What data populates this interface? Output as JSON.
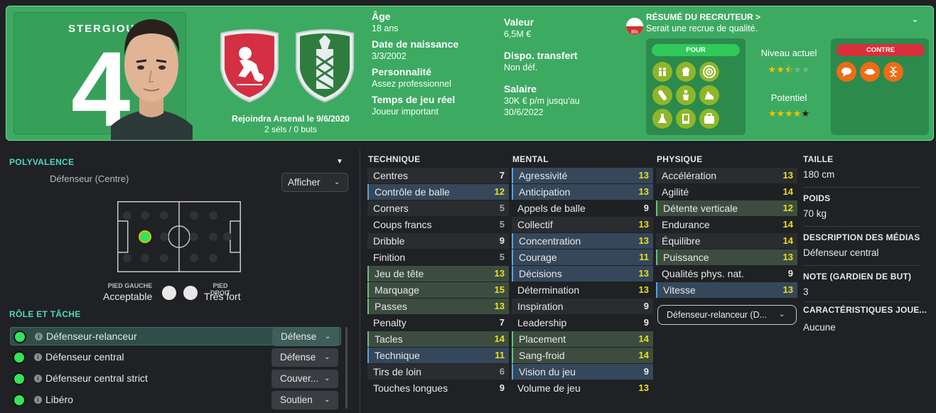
{
  "player": {
    "surname": "STERGIOU",
    "number": "4",
    "joined": "Rejoindra Arsenal le 9/6/2020",
    "caps": "2 séls / 0 buts"
  },
  "info": [
    {
      "label": "Âge",
      "value": "18 ans"
    },
    {
      "label": "Date de naissance",
      "value": "3/3/2002"
    },
    {
      "label": "Personnalité",
      "value": "Assez professionnel"
    },
    {
      "label": "Temps de jeu réel",
      "value": "Joueur important"
    }
  ],
  "info2": [
    {
      "label": "Valeur",
      "value": "6,5M €"
    },
    {
      "label": "Dispo. transfert",
      "value": "Non déf."
    },
    {
      "label": "Salaire",
      "value": "30K € p/m jusqu'au",
      "value2": "30/6/2022"
    }
  ],
  "scout": {
    "badge": "Bls",
    "title": "RÉSUMÉ DU RECRUTEUR",
    "arrow": ">",
    "summary": "Serait une recrue de qualité.",
    "pros_label": "POUR",
    "cons_label": "CONTRE",
    "current_label": "Niveau actuel",
    "potential_label": "Potentiel",
    "current_stars": 2.5,
    "potential_stars": 4,
    "pros_icons": [
      "team-icon",
      "brain-icon",
      "target-icon",
      "bandage-icon",
      "player-icon",
      "boot-icon",
      "flask-icon",
      "tablet-icon",
      "suitcase-icon"
    ],
    "cons_icons": [
      "speech-icon",
      "handshake-icon",
      "dna-icon"
    ],
    "colors": {
      "pros": "#8fb62a",
      "cons": "#ef6b14"
    }
  },
  "polyvalence": {
    "title": "POLYVALENCE",
    "position": "Défenseur (Centre)",
    "show_button": "Afficher",
    "left_foot_label": "PIED GAUCHE",
    "left_foot_value": "Acceptable",
    "right_foot_label": "PIED DROIT",
    "right_foot_value": "Très fort"
  },
  "roles": {
    "title": "RÔLE ET TÂCHE",
    "items": [
      {
        "name": "Défenseur-relanceur",
        "duty": "Défense"
      },
      {
        "name": "Défenseur central",
        "duty": "Défense"
      },
      {
        "name": "Défenseur central strict",
        "duty": "Couver..."
      },
      {
        "name": "Libéro",
        "duty": "Soutien"
      }
    ]
  },
  "attributes": {
    "technique_title": "TECHNIQUE",
    "mental_title": "MENTAL",
    "physique_title": "PHYSIQUE",
    "technique": [
      {
        "name": "Centres",
        "value": "7"
      },
      {
        "name": "Contrôle de balle",
        "value": "12"
      },
      {
        "name": "Corners",
        "value": "5"
      },
      {
        "name": "Coups francs",
        "value": "5"
      },
      {
        "name": "Dribble",
        "value": "9"
      },
      {
        "name": "Finition",
        "value": "5"
      },
      {
        "name": "Jeu de tête",
        "value": "13"
      },
      {
        "name": "Marquage",
        "value": "15"
      },
      {
        "name": "Passes",
        "value": "13"
      },
      {
        "name": "Penalty",
        "value": "7"
      },
      {
        "name": "Tacles",
        "value": "14"
      },
      {
        "name": "Technique",
        "value": "11"
      },
      {
        "name": "Tirs de loin",
        "value": "6"
      },
      {
        "name": "Touches longues",
        "value": "9"
      }
    ],
    "mental": [
      {
        "name": "Agressivité",
        "value": "13"
      },
      {
        "name": "Anticipation",
        "value": "13"
      },
      {
        "name": "Appels de balle",
        "value": "9"
      },
      {
        "name": "Collectif",
        "value": "13"
      },
      {
        "name": "Concentration",
        "value": "13"
      },
      {
        "name": "Courage",
        "value": "11"
      },
      {
        "name": "Décisions",
        "value": "13"
      },
      {
        "name": "Détermination",
        "value": "13"
      },
      {
        "name": "Inspiration",
        "value": "9"
      },
      {
        "name": "Leadership",
        "value": "9"
      },
      {
        "name": "Placement",
        "value": "14"
      },
      {
        "name": "Sang-froid",
        "value": "14"
      },
      {
        "name": "Vision du jeu",
        "value": "9"
      },
      {
        "name": "Volume de jeu",
        "value": "13"
      }
    ],
    "physique": [
      {
        "name": "Accélération",
        "value": "13"
      },
      {
        "name": "Agilité",
        "value": "14"
      },
      {
        "name": "Détente verticale",
        "value": "12"
      },
      {
        "name": "Endurance",
        "value": "14"
      },
      {
        "name": "Équilibre",
        "value": "14"
      },
      {
        "name": "Puissance",
        "value": "13"
      },
      {
        "name": "Qualités phys. nat.",
        "value": "9"
      },
      {
        "name": "Vitesse",
        "value": "13"
      }
    ],
    "role_select": "Défenseur-relanceur (D..."
  },
  "details": [
    {
      "label": "TAILLE",
      "value": "180 cm"
    },
    {
      "label": "POIDS",
      "value": "70 kg"
    },
    {
      "label": "DESCRIPTION DES MÉDIAS",
      "value": "Défenseur central"
    },
    {
      "label": "NOTE (GARDIEN DE BUT)",
      "value": "3"
    },
    {
      "label": "CARACTÉRISTIQUES JOUE...",
      "value": "Aucune"
    }
  ]
}
